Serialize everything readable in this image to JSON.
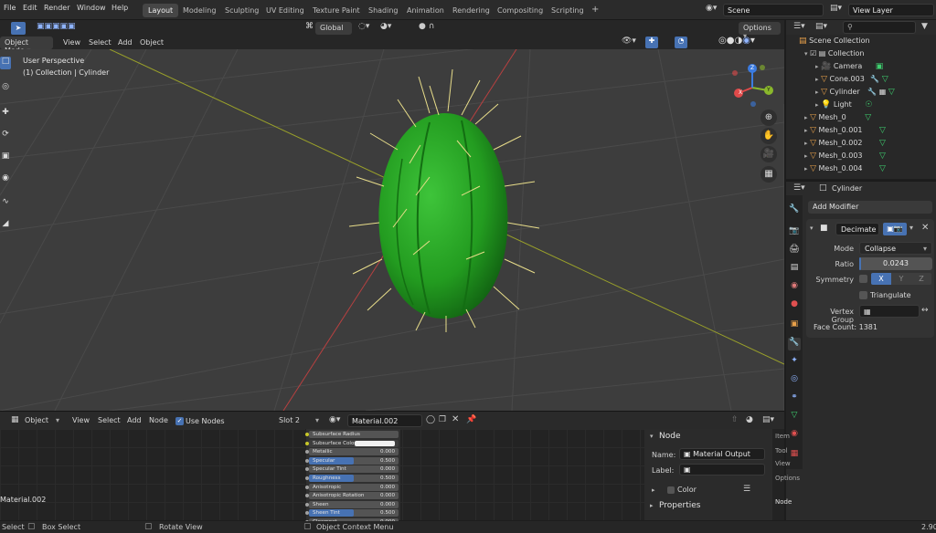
{
  "menus": [
    "File",
    "Edit",
    "Render",
    "Window",
    "Help"
  ],
  "workspaces": [
    "Layout",
    "Modeling",
    "Sculpting",
    "UV Editing",
    "Texture Paint",
    "Shading",
    "Animation",
    "Rendering",
    "Compositing",
    "Scripting"
  ],
  "active_workspace": "Layout",
  "plus_tab": "+",
  "scene_name": "Scene",
  "view_layer": "View Layer",
  "viewport_header": {
    "mode": "Object Mode",
    "menu": [
      "View",
      "Select",
      "Add",
      "Object"
    ],
    "transform_orientation": "Global",
    "options": "Options"
  },
  "viewport": {
    "view_name": "User Perspective",
    "collection_info": "(1) Collection | Cylinder",
    "gizmo_axes": [
      "X",
      "Y",
      "Z"
    ]
  },
  "outliner": {
    "search_placeholder": "",
    "rows": [
      {
        "label": "Scene Collection",
        "indent": 0
      },
      {
        "label": "Collection",
        "indent": 1
      },
      {
        "label": "Camera",
        "indent": 2
      },
      {
        "label": "Cone.003",
        "indent": 2
      },
      {
        "label": "Cylinder",
        "indent": 2
      },
      {
        "label": "Light",
        "indent": 2
      },
      {
        "label": "Mesh_0",
        "indent": 1
      },
      {
        "label": "Mesh_0.001",
        "indent": 1
      },
      {
        "label": "Mesh_0.002",
        "indent": 1
      },
      {
        "label": "Mesh_0.003",
        "indent": 1
      },
      {
        "label": "Mesh_0.004",
        "indent": 1
      }
    ]
  },
  "properties": {
    "object_name": "Cylinder",
    "add_modifier": "Add Modifier",
    "modifier_name": "Decimate",
    "mode_label": "Mode",
    "mode_value": "Collapse",
    "ratio_label": "Ratio",
    "ratio_value": "0.0243",
    "symmetry_label": "Symmetry",
    "axes": [
      "X",
      "Y",
      "Z"
    ],
    "triangulate": "Triangulate",
    "vertex_group_label": "Vertex Group",
    "face_count": "Face Count: 1381"
  },
  "node_header": {
    "type": "Object",
    "menu": [
      "View",
      "Select",
      "Add",
      "Node"
    ],
    "use_nodes": "Use Nodes",
    "slot": "Slot 2",
    "material": "Material.002"
  },
  "node_editor": {
    "material_label": "Material.002",
    "bsdf_rows": [
      {
        "label": "Subsurface Radius",
        "value": "",
        "fill": 0
      },
      {
        "label": "Subsurface Color",
        "value": "",
        "fill": 0
      },
      {
        "label": "Metallic",
        "value": "0.000",
        "fill": 0
      },
      {
        "label": "Specular",
        "value": "0.500",
        "fill": 0.5
      },
      {
        "label": "Specular Tint",
        "value": "0.000",
        "fill": 0
      },
      {
        "label": "Roughness",
        "value": "0.500",
        "fill": 0.5
      },
      {
        "label": "Anisotropic",
        "value": "0.000",
        "fill": 0
      },
      {
        "label": "Anisotropic Rotation",
        "value": "0.000",
        "fill": 0
      },
      {
        "label": "Sheen",
        "value": "0.000",
        "fill": 0
      },
      {
        "label": "Sheen Tint",
        "value": "0.500",
        "fill": 0.5
      },
      {
        "label": "Clearcoat",
        "value": "0.000",
        "fill": 0
      }
    ]
  },
  "node_sidebar": {
    "section": "Node",
    "name_label": "Name:",
    "name_value": "Material Output",
    "label_label": "Label:",
    "label_value": "",
    "color": "Color",
    "properties": "Properties",
    "tabs": [
      "Item",
      "Tool",
      "View",
      "Options",
      "Node"
    ]
  },
  "statusbar": {
    "select": "Select",
    "box_select": "Box Select",
    "rotate_view": "Rotate View",
    "context_menu": "Object Context Menu",
    "version": "2.90"
  },
  "colors": {
    "accent": "#4772b3",
    "cactus": "#2e9a2a",
    "spine": "#e8dd8a",
    "x_axis": "#e04a4a",
    "y_axis": "#8ab82c",
    "z_axis": "#3b7be0"
  }
}
